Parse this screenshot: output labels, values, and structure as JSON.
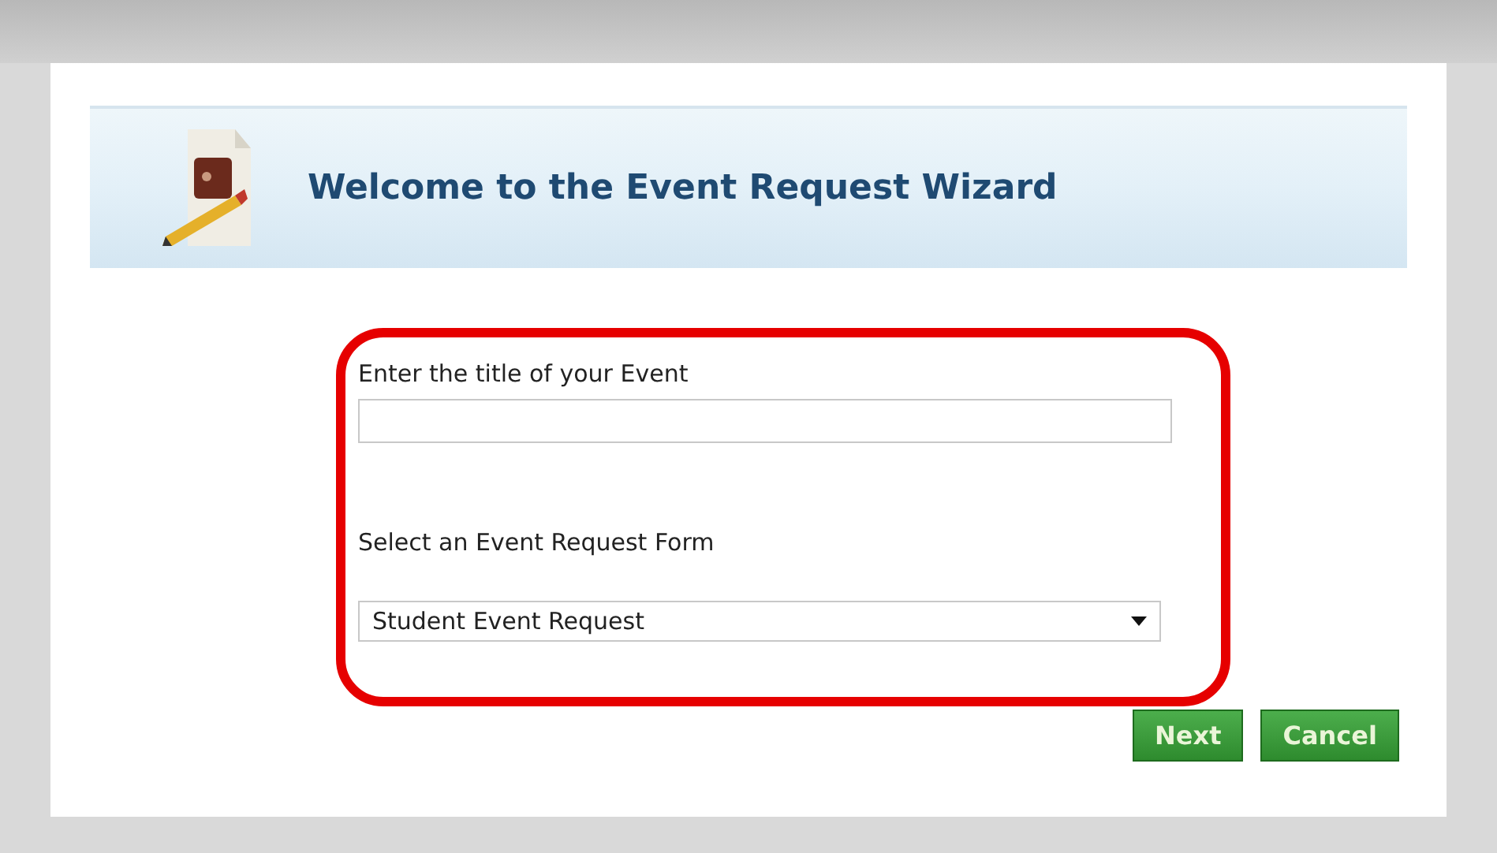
{
  "header": {
    "title": "Welcome to the Event Request Wizard"
  },
  "title_field": {
    "label": "Enter the title of your Event"
  },
  "form_select": {
    "label": "Select an Event Request Form",
    "value": "Student Event Request"
  },
  "buttons": [
    {
      "label": "Next"
    },
    {
      "label": "Cancel"
    }
  ]
}
